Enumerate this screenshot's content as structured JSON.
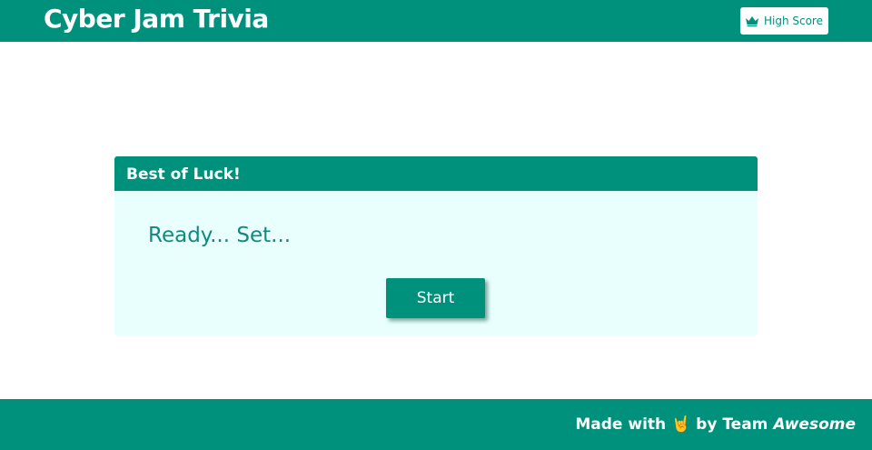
{
  "header": {
    "title": "Cyber Jam Trivia",
    "high_score_label": "High Score",
    "high_score_icon": "crown-icon"
  },
  "card": {
    "title": "Best of Luck!",
    "message": "Ready... Set...",
    "start_label": "Start"
  },
  "footer": {
    "made_with": "Made with",
    "emoji": "🤘",
    "by": "by Team",
    "team": "Awesome"
  },
  "colors": {
    "accent": "#00917d",
    "card_bg": "#e8fffd"
  }
}
